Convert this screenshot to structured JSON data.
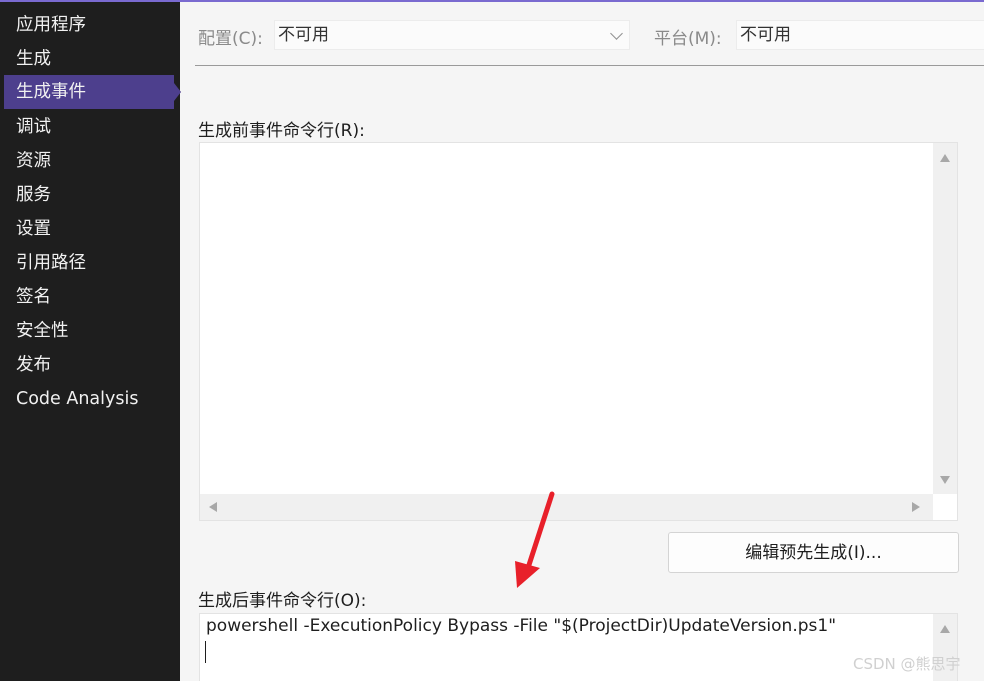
{
  "sidebar": {
    "items": [
      {
        "label": "应用程序"
      },
      {
        "label": "生成"
      },
      {
        "label": "生成事件"
      },
      {
        "label": "调试"
      },
      {
        "label": "资源"
      },
      {
        "label": "服务"
      },
      {
        "label": "设置"
      },
      {
        "label": "引用路径"
      },
      {
        "label": "签名"
      },
      {
        "label": "安全性"
      },
      {
        "label": "发布"
      },
      {
        "label": "Code Analysis"
      }
    ],
    "active_label": "生成事件"
  },
  "toolbar": {
    "config_label": "配置(C):",
    "config_value": "不可用",
    "platform_label": "平台(M):",
    "platform_value": "不可用"
  },
  "prebuild": {
    "label": "生成前事件命令行(R):",
    "value": "",
    "edit_button": "编辑预先生成(I)..."
  },
  "postbuild": {
    "label": "生成后事件命令行(O):",
    "value": "powershell -ExecutionPolicy Bypass -File \"$(ProjectDir)UpdateVersion.ps1\""
  },
  "annotation": {
    "arrow_color": "#e8202a"
  },
  "colors": {
    "sidebar_bg": "#1e1e1e",
    "active_bg": "#4d3f8d",
    "accent_line": "#7a6ad0"
  },
  "watermark": "CSDN @熊思宇"
}
